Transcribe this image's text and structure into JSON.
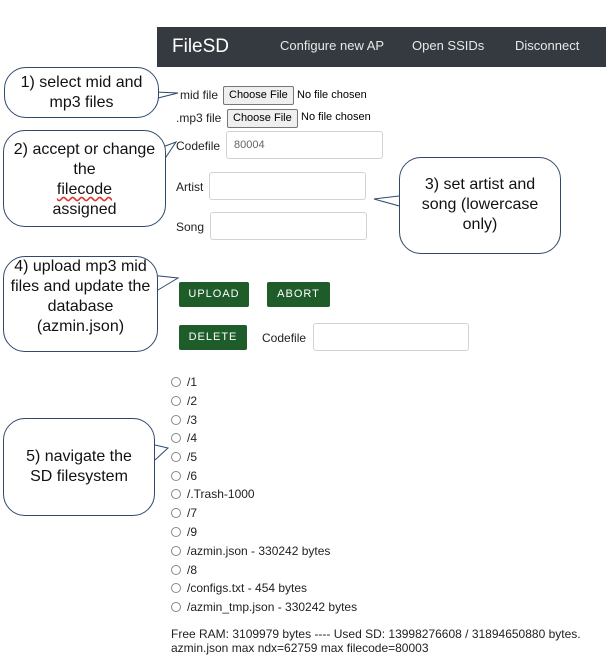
{
  "navbar": {
    "brand": "FileSD",
    "links": [
      "Configure new AP",
      "Open SSIDs",
      "Disconnect"
    ]
  },
  "form": {
    "mid_label": "mid file",
    "mp3_label": ".mp3 file",
    "choose_file": "Choose File",
    "no_file": "No file chosen",
    "codefile_label": "Codefile",
    "codefile_value": "80004",
    "artist_label": "Artist",
    "song_label": "Song",
    "upload": "UPLOAD",
    "abort": "ABORT",
    "delete": "DELETE",
    "delete_codefile_label": "Codefile"
  },
  "files": [
    "/1",
    "/2",
    "/3",
    "/4",
    "/5",
    "/6",
    "/.Trash-1000",
    "/7",
    "/9",
    "/azmin.json - 330242 bytes",
    "/8",
    "/configs.txt - 454 bytes",
    "/azmin_tmp.json - 330242 bytes"
  ],
  "footer": {
    "line1": "Free RAM: 3109979 bytes ---- Used SD: 13998276608 / 31894650880 bytes.",
    "line2": "azmin.json max ndx=62759 max filecode=80003"
  },
  "callouts": {
    "c1": "1) select mid and mp3 files",
    "c2a": "2) accept or change the",
    "c2b": "filecode",
    "c2c": "assigned",
    "c3": "3) set artist and song (lowercase only)",
    "c4": "4) upload mp3 mid files and update the database (azmin.json)",
    "c5": "5) navigate the SD filesystem"
  }
}
